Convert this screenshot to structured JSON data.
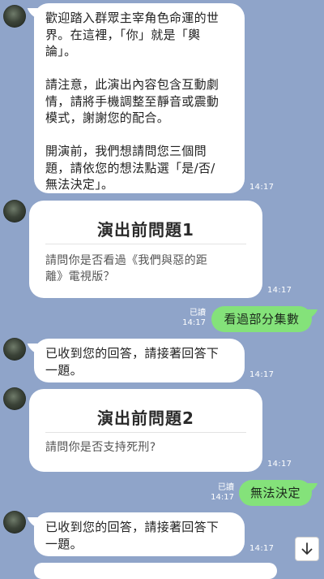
{
  "messages": {
    "m1": {
      "lines": [
        "歡迎踏入群眾主宰角色命運的世",
        "界。在這裡，「你」就是「輿",
        "論」。",
        "",
        "請注意，此演出內容包含互動劇",
        "情，請將手機調整至靜音或震動",
        "模式，謝謝您的配合。",
        "",
        "開演前，我們想請問您三個問",
        "題，請依您的想法點選「是/否/",
        "無法決定」。"
      ],
      "time": "14:17"
    },
    "q1": {
      "title": "演出前問題1",
      "body": [
        "請問你是否看過《我們與惡的距",
        "離》電視版？"
      ],
      "time": "14:17"
    },
    "reply1": {
      "read": "已讀",
      "time": "14:17",
      "text": "看過部分集數"
    },
    "ack1": {
      "lines": [
        "已收到您的回答，請接著回答下",
        "一題。"
      ],
      "time": "14:17"
    },
    "q2": {
      "title": "演出前問題2",
      "body": [
        "請問你是否支持死刑?"
      ],
      "time": "14:17"
    },
    "reply2": {
      "read": "已讀",
      "time": "14:17",
      "text": "無法決定"
    },
    "ack2": {
      "lines": [
        "已收到您的回答，請接著回答下",
        "一題。"
      ],
      "time": "14:17"
    }
  },
  "icons": {
    "avatar": "avatar-image",
    "scroll": "arrow-down-icon"
  },
  "colors": {
    "background": "#8fa4c9",
    "user_bubble": "#84e27a",
    "bot_bubble": "#ffffff"
  }
}
